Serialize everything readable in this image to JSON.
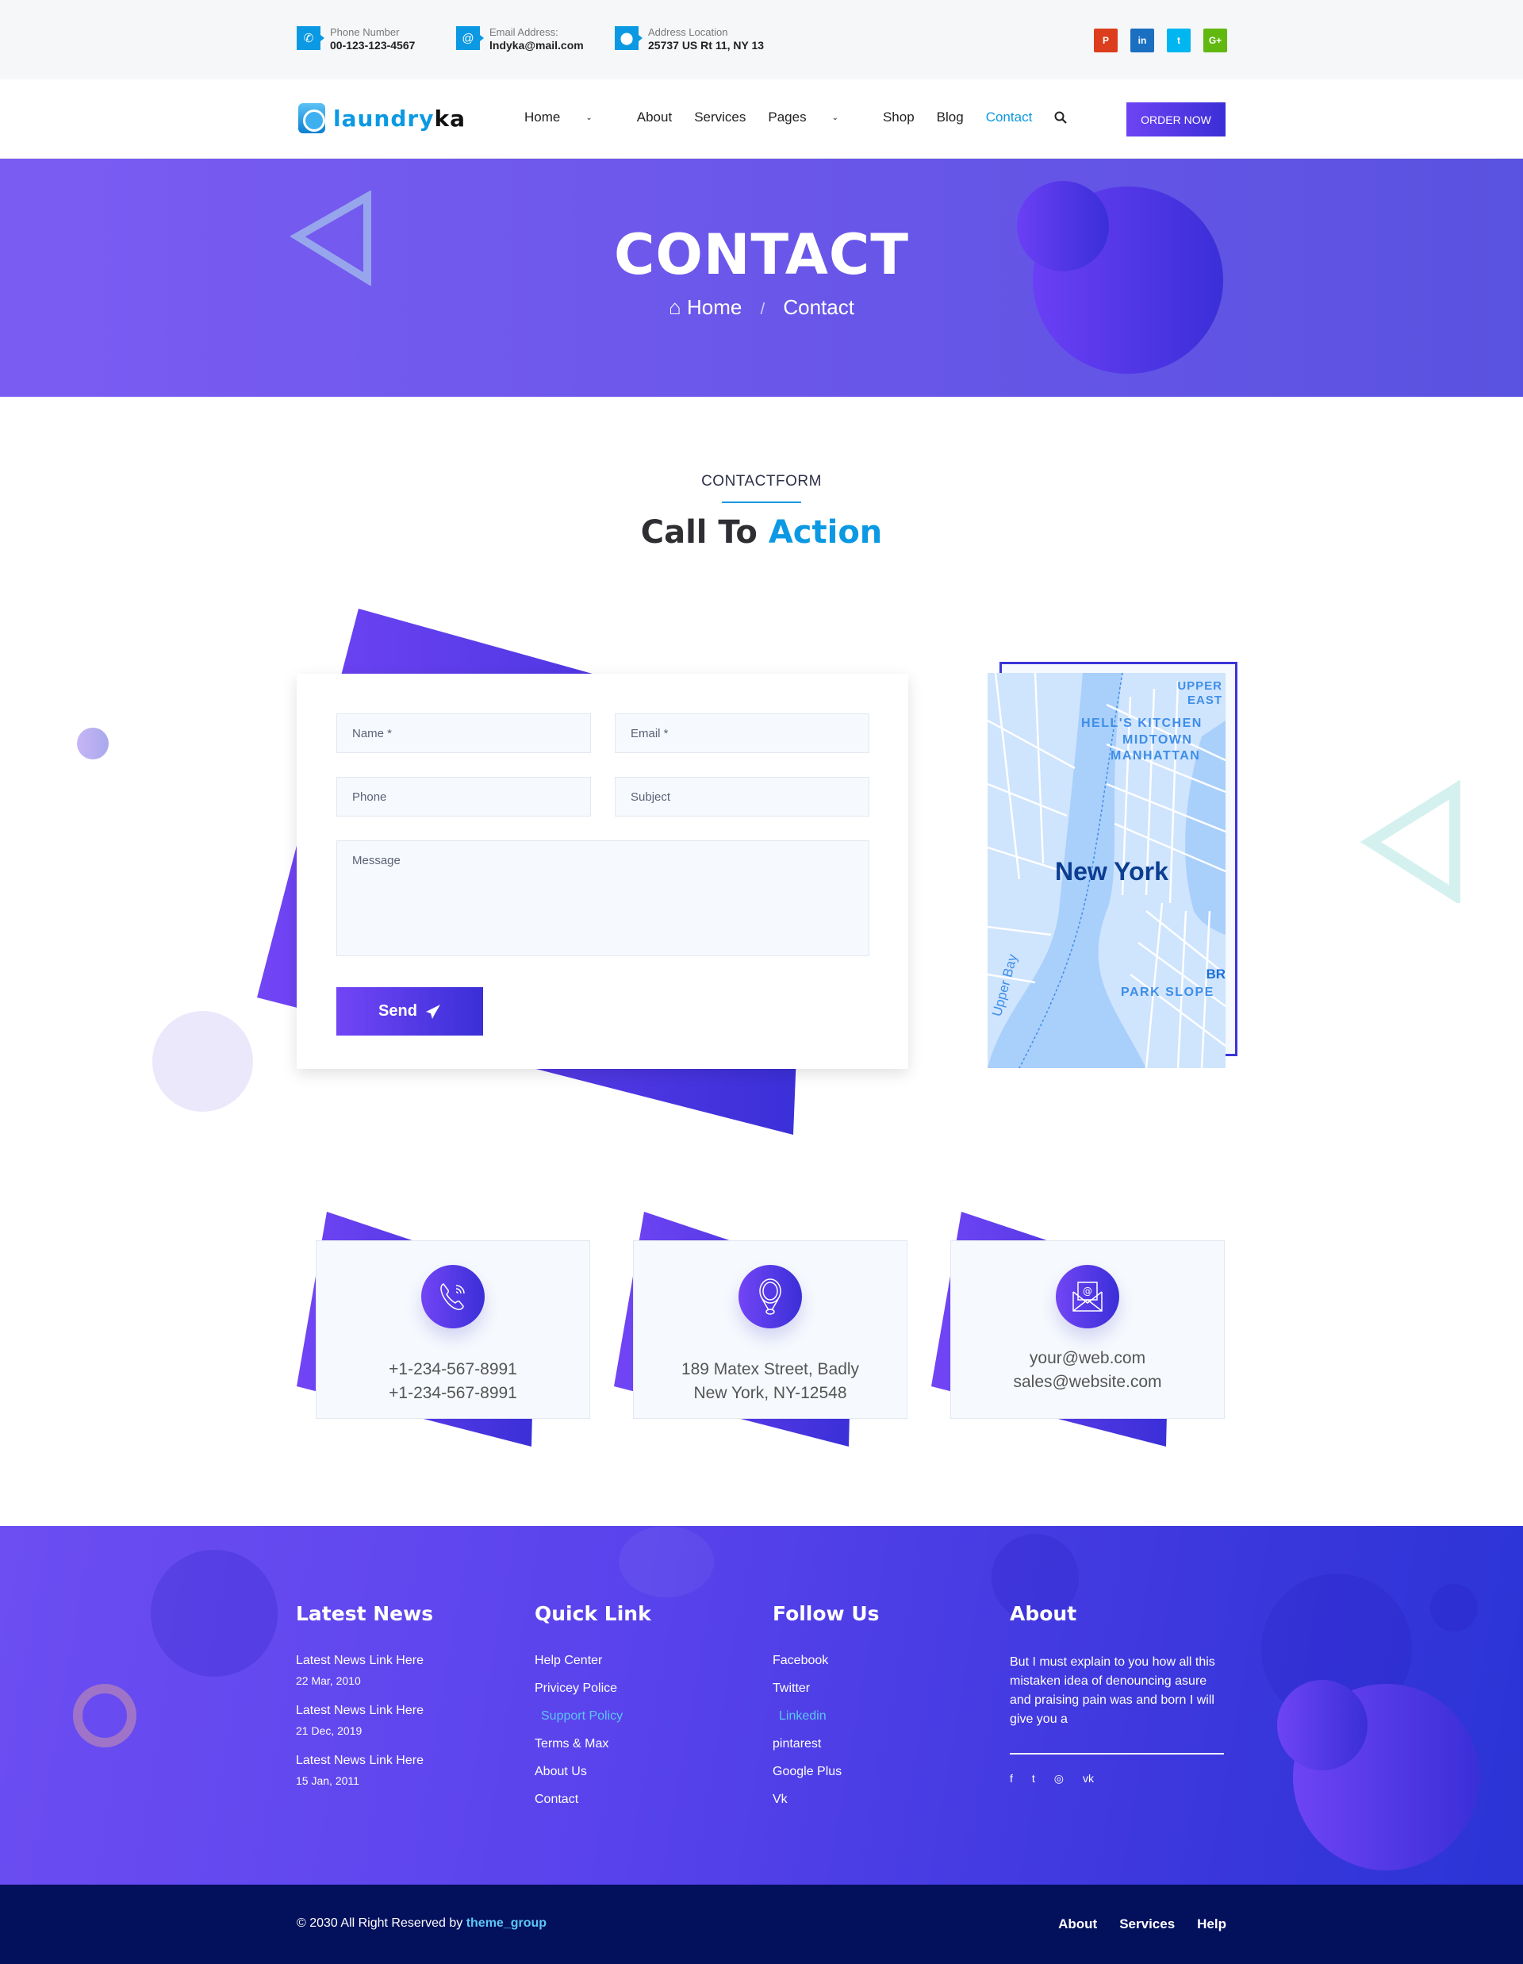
{
  "topbar": {
    "phone": {
      "label": "Phone Number",
      "value": "00-123-123-4567",
      "icon": "phone-icon"
    },
    "email": {
      "label": "Email Address:",
      "value": "lndyka@mail.com",
      "icon": "at-icon"
    },
    "address": {
      "label": "Address Location",
      "value": "25737 US Rt 11, NY 13",
      "icon": "map-pin-icon"
    },
    "social": [
      {
        "name": "pinterest",
        "glyph": "P",
        "color": "#dc3e1d"
      },
      {
        "name": "linkedin",
        "glyph": "in",
        "color": "#1a6fc1"
      },
      {
        "name": "twitter",
        "glyph": "t",
        "color": "#00b6f1"
      },
      {
        "name": "google-plus",
        "glyph": "G+",
        "color": "#61b90f"
      }
    ]
  },
  "brand": {
    "name_a": "laundry",
    "name_b": "ka"
  },
  "nav": {
    "items": [
      {
        "label": "Home",
        "dropdown": true
      },
      {
        "label": "About"
      },
      {
        "label": "Services"
      },
      {
        "label": "Pages",
        "dropdown": true
      },
      {
        "label": "Shop"
      },
      {
        "label": "Blog"
      },
      {
        "label": "Contact",
        "active": true
      }
    ],
    "order_label": "ORDER NOW"
  },
  "hero": {
    "title": "CONTACT",
    "breadcrumb": {
      "home": "Home",
      "separator": "/",
      "current": "Contact"
    }
  },
  "section": {
    "kicker": "CONTACTFORM",
    "title_a": "Call To",
    "title_b": "Action"
  },
  "form": {
    "name_placeholder": "Name *",
    "email_placeholder": "Email *",
    "phone_placeholder": "Phone",
    "subject_placeholder": "Subject",
    "message_placeholder": "Message",
    "send_label": "Send"
  },
  "map": {
    "labels": [
      "UPPER",
      "EAST",
      "HELL'S KITCHEN",
      "MIDTOWN",
      "MANHATTAN",
      "New York",
      "BR",
      "PARK SLOPE",
      "Upper Bay"
    ]
  },
  "info_cards": [
    {
      "icon": "phone-call-icon",
      "lines": [
        "+1-234-567-8991",
        "+1-234-567-8991"
      ]
    },
    {
      "icon": "location-pin-icon",
      "lines": [
        "189 Matex Street, Badly",
        "New York, NY-12548"
      ]
    },
    {
      "icon": "envelope-icon",
      "lines": [
        "your@web.com",
        "sales@website.com"
      ]
    }
  ],
  "footer": {
    "news": {
      "title": "Latest News",
      "items": [
        {
          "title": "Latest News Link Here",
          "date": "22 Mar, 2010"
        },
        {
          "title": "Latest News Link Here",
          "date": "21 Dec, 2019"
        },
        {
          "title": "Latest News Link Here",
          "date": "15 Jan, 2011"
        }
      ]
    },
    "quick": {
      "title": "Quick Link",
      "items": [
        "Help Center",
        "Privicey Police",
        "Support Policy",
        "Terms & Max",
        "About Us",
        "Contact"
      ]
    },
    "follow": {
      "title": "Follow Us",
      "items": [
        "Facebook",
        "Twitter",
        "Linkedin",
        "pintarest",
        "Google Plus",
        "Vk"
      ]
    },
    "about": {
      "title": "About",
      "text": "But I must explain to you how all this mistaken idea of denouncing asure and praising pain was and born I will give you a",
      "social": [
        {
          "name": "facebook",
          "glyph": "f"
        },
        {
          "name": "twitter",
          "glyph": "t"
        },
        {
          "name": "instagram",
          "glyph": "◎"
        },
        {
          "name": "vk",
          "glyph": "vk"
        }
      ]
    }
  },
  "bottom": {
    "copyright": "© 2030 All Right Reserved by",
    "brand": "theme_group",
    "links": [
      "About",
      "Services",
      "Help"
    ]
  },
  "colors": {
    "accent": "#0b99e3",
    "primary_gradient_start": "#7245f5",
    "primary_gradient_end": "#3a2fd8",
    "bottom_bar": "#03105c"
  }
}
